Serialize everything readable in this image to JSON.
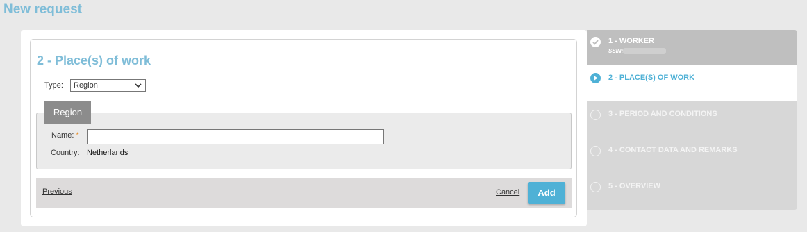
{
  "page": {
    "title": "New request"
  },
  "form": {
    "section_title": "2 - Place(s) of work",
    "type_label": "Type:",
    "type_value": "Region",
    "region_tab": "Region",
    "name_label": "Name:",
    "required_marker": "*",
    "name_value": "",
    "country_label": "Country:",
    "country_value": "Netherlands"
  },
  "footer": {
    "previous_label": "Previous",
    "cancel_label": "Cancel",
    "add_label": "Add"
  },
  "steps": [
    {
      "label": "1 - WORKER",
      "sub_label": "SSIN:",
      "status": "completed"
    },
    {
      "label": "2 - PLACE(S) OF WORK",
      "status": "active"
    },
    {
      "label": "3 - PERIOD AND CONDITIONS",
      "status": "pending"
    },
    {
      "label": "4 - CONTACT DATA AND REMARKS",
      "status": "pending"
    },
    {
      "label": "5 - OVERVIEW",
      "status": "pending"
    }
  ],
  "icons": {
    "step_completed": "check-icon",
    "step_active": "play-icon",
    "type_select": "chevron-down-icon"
  },
  "colors": {
    "accent": "#4fb1d6",
    "title": "#7fbdd8",
    "required": "#e8912d"
  }
}
